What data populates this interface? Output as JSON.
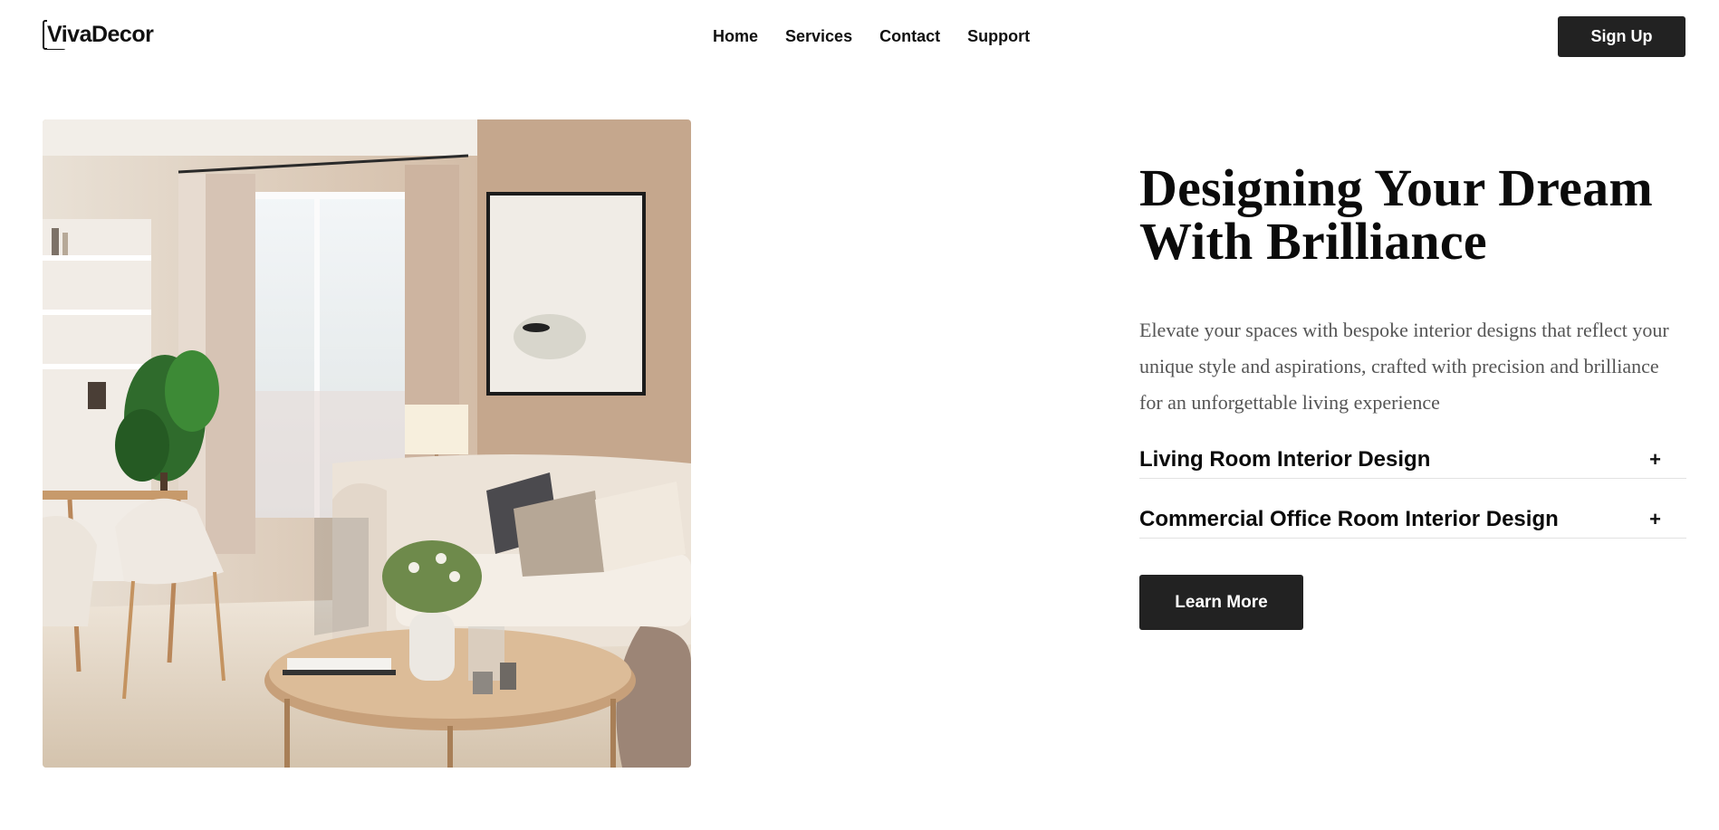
{
  "header": {
    "logo_text": "VivaDecor",
    "nav": [
      "Home",
      "Services",
      "Contact",
      "Support"
    ],
    "signup_label": "Sign Up"
  },
  "hero": {
    "title_line1": "Designing Your Dream",
    "title_line2": "With Brilliance",
    "description": "Elevate your spaces with bespoke interior designs that reflect your unique style and aspirations, crafted with precision and brilliance for an unforgettable living experience",
    "accordion": [
      {
        "label": "Living Room Interior Design",
        "icon": "+"
      },
      {
        "label": "Commercial Office Room Interior Design",
        "icon": "+"
      }
    ],
    "cta_label": "Learn More"
  },
  "colors": {
    "background": "#ffffff",
    "button": "#222222",
    "text": "#111111",
    "description": "#555555",
    "divider": "#e2e2e2"
  }
}
